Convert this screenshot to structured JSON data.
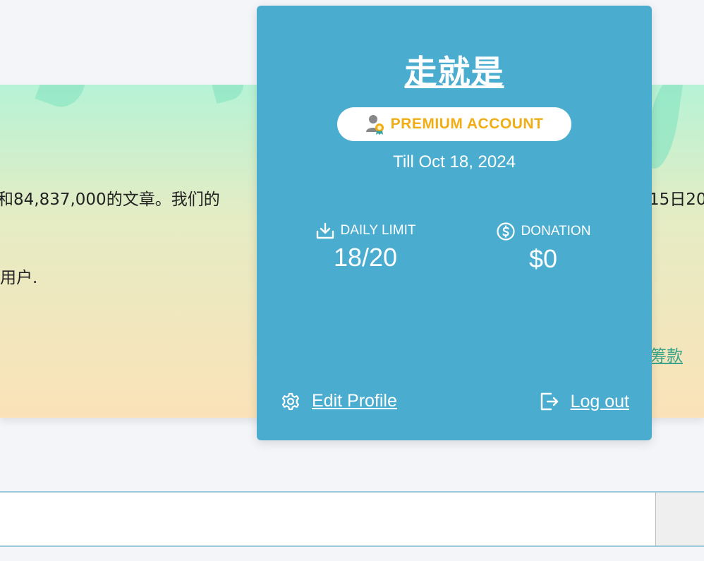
{
  "banner": {
    "line1": "和84,837,000的文章。我们的",
    "line1_right": "15日20",
    "line2": "用户.",
    "link": "筹款"
  },
  "popup": {
    "username": "走就是",
    "badge": {
      "label": "PREMIUM ACCOUNT",
      "icon": "user-award-icon",
      "color": "#f0ad14"
    },
    "till": "Till Oct 18, 2024",
    "stats": [
      {
        "icon": "download-icon",
        "label": "DAILY LIMIT",
        "value": "18/20"
      },
      {
        "icon": "dollar-circle-icon",
        "label": "DONATION",
        "value": "$0"
      }
    ],
    "edit_profile": {
      "label": "Edit Profile",
      "icon": "gear-icon"
    },
    "logout": {
      "label": "Log out",
      "icon": "logout-icon"
    },
    "background": "#4aadd0"
  }
}
